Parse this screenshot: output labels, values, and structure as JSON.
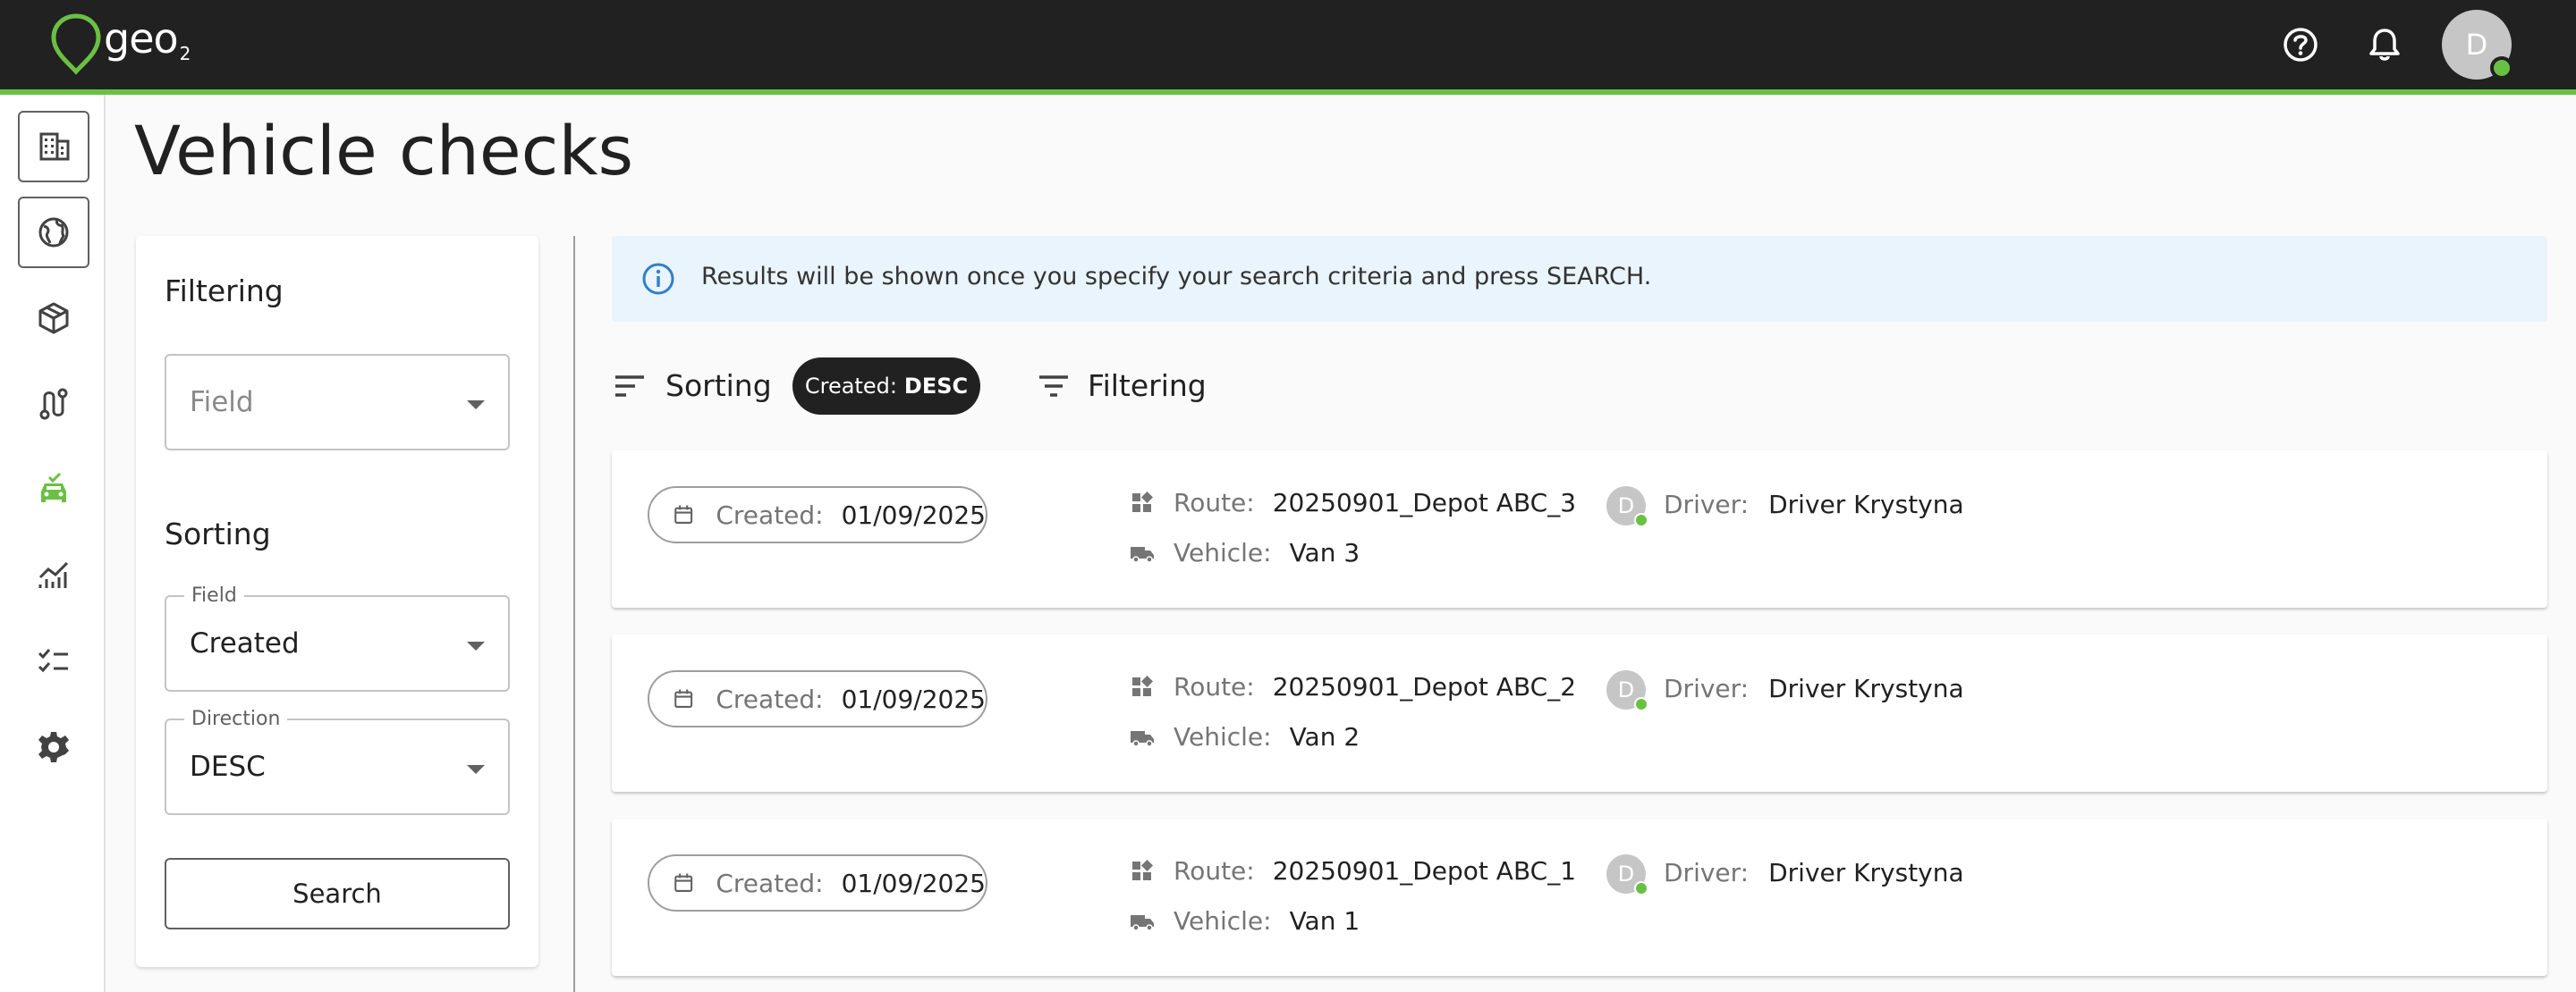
{
  "app": {
    "logo_text": "geo",
    "logo_sub": "2"
  },
  "header": {
    "user_initial": "D"
  },
  "page": {
    "title": "Vehicle checks"
  },
  "filter_panel": {
    "filtering_heading": "Filtering",
    "filter_field_placeholder": "Field",
    "sorting_heading": "Sorting",
    "sort_field_label": "Field",
    "sort_field_value": "Created",
    "direction_label": "Direction",
    "direction_value": "DESC",
    "search_label": "Search"
  },
  "info_banner": {
    "text": "Results will be shown once you specify your search criteria and press SEARCH."
  },
  "toolbar": {
    "sorting_label": "Sorting",
    "chip_key": "Created:",
    "chip_value": "DESC",
    "filtering_label": "Filtering"
  },
  "labels": {
    "created": "Created:",
    "route": "Route:",
    "vehicle": "Vehicle:",
    "driver": "Driver:"
  },
  "results": [
    {
      "created": "01/09/2025",
      "route": "20250901_Depot ABC_3",
      "vehicle": "Van 3",
      "driver_initial": "D",
      "driver": "Driver Krystyna"
    },
    {
      "created": "01/09/2025",
      "route": "20250901_Depot ABC_2",
      "vehicle": "Van 2",
      "driver_initial": "D",
      "driver": "Driver Krystyna"
    },
    {
      "created": "01/09/2025",
      "route": "20250901_Depot ABC_1",
      "vehicle": "Van 1",
      "driver_initial": "D",
      "driver": "Driver Krystyna"
    }
  ],
  "colors": {
    "accent": "#6ac043",
    "topbar": "#212121",
    "info_bg": "#eaf4fd",
    "info_icon": "#2f80c8"
  }
}
